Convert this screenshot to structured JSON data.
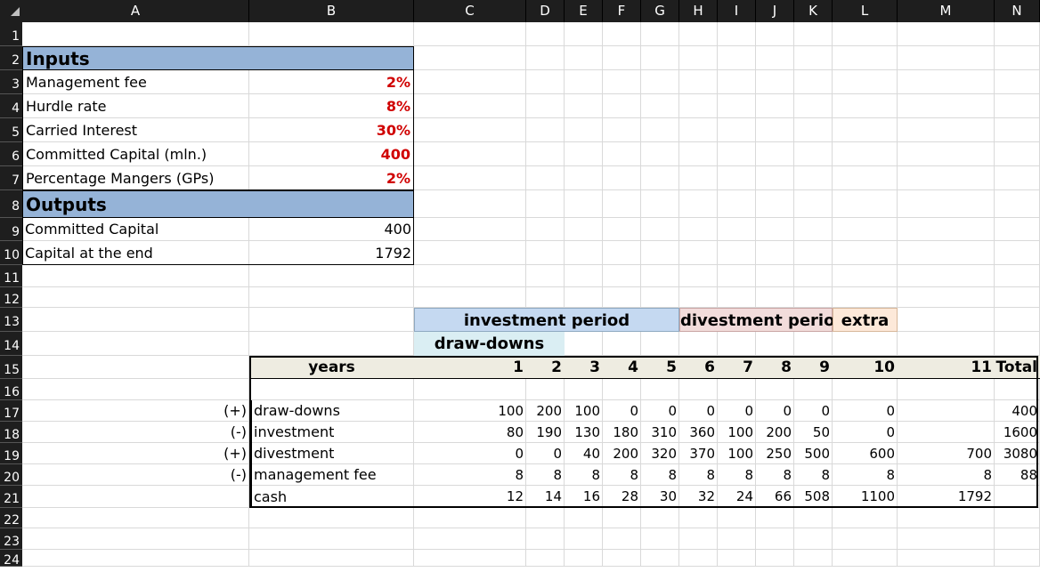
{
  "columns": [
    "A",
    "B",
    "C",
    "D",
    "E",
    "F",
    "G",
    "H",
    "I",
    "J",
    "K",
    "L",
    "M",
    "N"
  ],
  "rows": [
    "1",
    "2",
    "3",
    "4",
    "5",
    "6",
    "7",
    "8",
    "9",
    "10",
    "11",
    "12",
    "13",
    "14",
    "15",
    "16",
    "17",
    "18",
    "19",
    "20",
    "21",
    "22",
    "23",
    "24"
  ],
  "inputs": {
    "title": "Inputs",
    "items": [
      {
        "label": "Management fee",
        "value": "2%"
      },
      {
        "label": "Hurdle rate",
        "value": "8%"
      },
      {
        "label": "Carried Interest",
        "value": "30%"
      },
      {
        "label": "Committed Capital (mln.)",
        "value": "400"
      },
      {
        "label": "Percentage Mangers (GPs)",
        "value": "2%"
      }
    ]
  },
  "outputs": {
    "title": "Outputs",
    "items": [
      {
        "label": "Committed Capital",
        "value": "400"
      },
      {
        "label": "Capital at the end",
        "value": "1792"
      }
    ]
  },
  "bands": {
    "investment_period": "investment period",
    "divestment_period": "divestment period",
    "extra": "extra",
    "draw_downs": "draw-downs"
  },
  "colors": {
    "investment_band": "#c5d9f1",
    "divestment_band": "#f2dcdb",
    "extra_band": "#fde9d9",
    "drawdown_band": "#daeef3",
    "section_header": "#95b3d7",
    "table_header": "#eeece1"
  },
  "table": {
    "years_label": "years",
    "years": [
      "1",
      "2",
      "3",
      "4",
      "5",
      "6",
      "7",
      "8",
      "9",
      "10",
      "11"
    ],
    "total_label": "Total",
    "rows": [
      {
        "sign": "(+)",
        "label": "draw-downs",
        "values": [
          "100",
          "200",
          "100",
          "0",
          "0",
          "0",
          "0",
          "0",
          "0",
          "0",
          ""
        ],
        "total": "400"
      },
      {
        "sign": "(-)",
        "label": "investment",
        "values": [
          "80",
          "190",
          "130",
          "180",
          "310",
          "360",
          "100",
          "200",
          "50",
          "0",
          ""
        ],
        "total": "1600"
      },
      {
        "sign": "(+)",
        "label": "divestment",
        "values": [
          "0",
          "0",
          "40",
          "200",
          "320",
          "370",
          "100",
          "250",
          "500",
          "600",
          "700"
        ],
        "total": "3080"
      },
      {
        "sign": "(-)",
        "label": "management fee",
        "values": [
          "8",
          "8",
          "8",
          "8",
          "8",
          "8",
          "8",
          "8",
          "8",
          "8",
          "8"
        ],
        "total": "88"
      },
      {
        "sign": "",
        "label": "cash",
        "values": [
          "12",
          "14",
          "16",
          "28",
          "30",
          "32",
          "24",
          "66",
          "508",
          "1100",
          "1792"
        ],
        "total": ""
      }
    ]
  }
}
